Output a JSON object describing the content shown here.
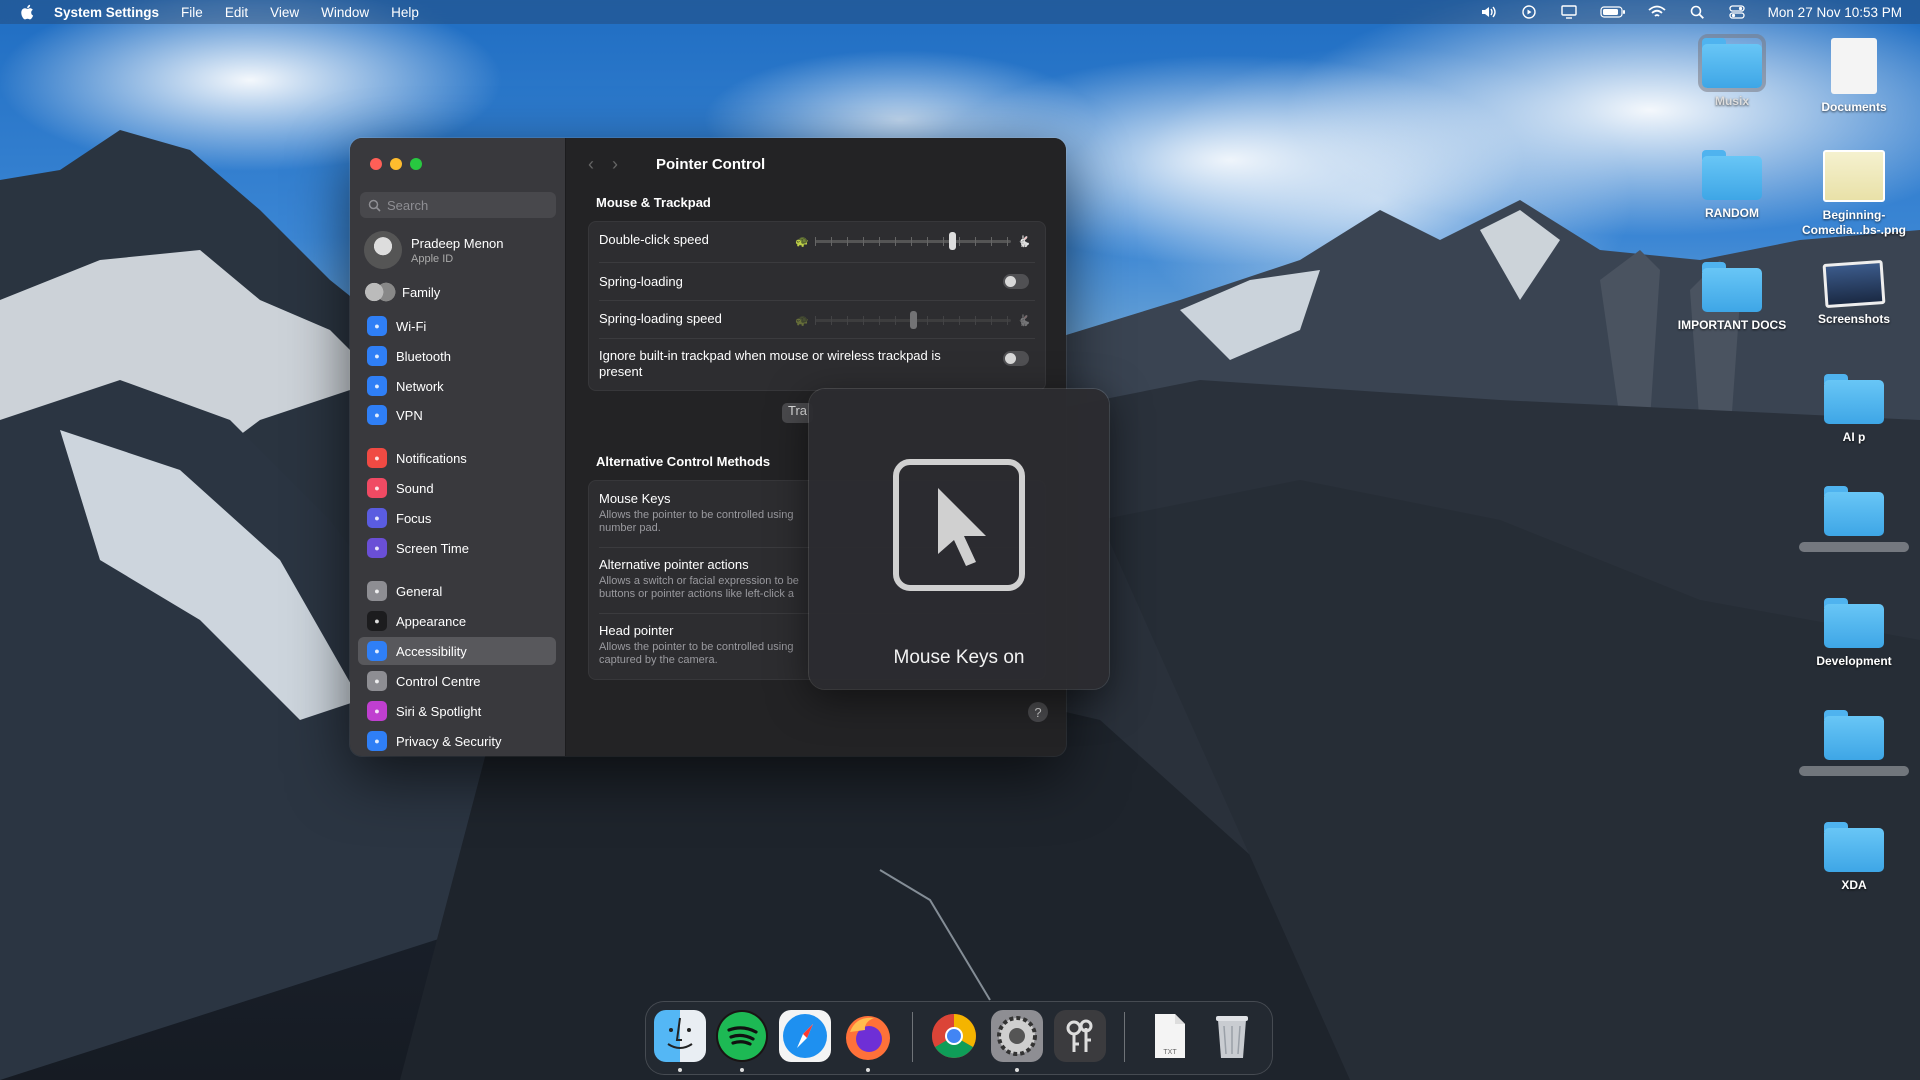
{
  "menubar": {
    "app_name": "System Settings",
    "menus": [
      "File",
      "Edit",
      "View",
      "Window",
      "Help"
    ],
    "clock": "Mon 27 Nov  10:53 PM",
    "status_icons": [
      "volume-icon",
      "play-icon",
      "display-icon",
      "battery-icon",
      "wifi-icon",
      "spotlight-icon",
      "control-center-icon"
    ]
  },
  "window": {
    "search_placeholder": "Search",
    "profile": {
      "name": "Pradeep Menon",
      "subtitle": "Apple ID"
    },
    "family_label": "Family",
    "sidebar_items": [
      {
        "label": "Wi-Fi",
        "icon": "wifi-icon",
        "color": "#2f7ff6"
      },
      {
        "label": "Bluetooth",
        "icon": "bluetooth-icon",
        "color": "#2f7ff6"
      },
      {
        "label": "Network",
        "icon": "globe-icon",
        "color": "#2f7ff6"
      },
      {
        "label": "VPN",
        "icon": "globe-icon",
        "color": "#2f7ff6"
      },
      {
        "label": "Notifications",
        "icon": "bell-icon",
        "color": "#f04a43"
      },
      {
        "label": "Sound",
        "icon": "speaker-icon",
        "color": "#f04a63"
      },
      {
        "label": "Focus",
        "icon": "moon-icon",
        "color": "#5a5ce0"
      },
      {
        "label": "Screen Time",
        "icon": "hourglass-icon",
        "color": "#6a4fd6"
      },
      {
        "label": "General",
        "icon": "gear-icon",
        "color": "#8e8e93"
      },
      {
        "label": "Appearance",
        "icon": "appearance-icon",
        "color": "#1c1c1e"
      },
      {
        "label": "Accessibility",
        "icon": "accessibility-icon",
        "color": "#2f7ff6"
      },
      {
        "label": "Control Centre",
        "icon": "control-center-icon",
        "color": "#8e8e93"
      },
      {
        "label": "Siri & Spotlight",
        "icon": "siri-icon",
        "color": "#c03fd0"
      },
      {
        "label": "Privacy & Security",
        "icon": "hand-icon",
        "color": "#2f7ff6"
      }
    ],
    "active_item": "Accessibility",
    "page_title": "Pointer Control",
    "mouse_section": {
      "heading": "Mouse & Trackpad",
      "double_click_speed": {
        "label": "Double-click speed",
        "value": 0.7
      },
      "spring_loading": {
        "label": "Spring-loading",
        "enabled": false
      },
      "spring_loading_speed": {
        "label": "Spring-loading speed",
        "value": 0.5
      },
      "ignore_trackpad": {
        "label": "Ignore built-in trackpad when mouse or wireless trackpad is present",
        "enabled": false
      }
    },
    "trackpad_button_partial": "Tra",
    "alt_section": {
      "heading": "Alternative Control Methods",
      "items": [
        {
          "title": "Mouse Keys",
          "desc": "Allows the pointer to be controlled using",
          "desc2": "number pad."
        },
        {
          "title": "Alternative pointer actions",
          "desc": "Allows a switch or facial expression to be",
          "desc2": "buttons or pointer actions like left-click a"
        },
        {
          "title": "Head pointer",
          "desc": "Allows the pointer to be controlled using",
          "desc2": "captured by the camera."
        }
      ]
    },
    "help_label": "?"
  },
  "hud": {
    "label": "Mouse Keys on"
  },
  "desktop": {
    "icons": [
      {
        "label": "Musix",
        "kind": "folder",
        "selected": true
      },
      {
        "label": "Documents",
        "kind": "doc"
      },
      {
        "label": "RANDOM",
        "kind": "folder"
      },
      {
        "label": "Beginning-Comedia...bs-.png",
        "kind": "image"
      },
      {
        "label": "IMPORTANT DOCS",
        "kind": "folder"
      },
      {
        "label": "Screenshots",
        "kind": "shot"
      },
      {
        "label": "AI p",
        "kind": "folder"
      },
      {
        "label": "",
        "kind": "folder"
      },
      {
        "label": "Development",
        "kind": "folder"
      },
      {
        "label": "",
        "kind": "folder"
      },
      {
        "label": "XDA",
        "kind": "folder"
      }
    ]
  },
  "dock": {
    "apps": [
      {
        "name": "finder-icon",
        "running": true
      },
      {
        "name": "spotify-icon",
        "running": true
      },
      {
        "name": "safari-icon",
        "running": false
      },
      {
        "name": "firefox-icon",
        "running": true
      },
      {
        "name": "chrome-icon",
        "running": false
      },
      {
        "name": "system-settings-icon",
        "running": true
      },
      {
        "name": "keychain-icon",
        "running": false
      },
      {
        "name": "text-file-icon",
        "running": false
      },
      {
        "name": "trash-icon",
        "running": false
      }
    ],
    "file_label": "TXT"
  }
}
